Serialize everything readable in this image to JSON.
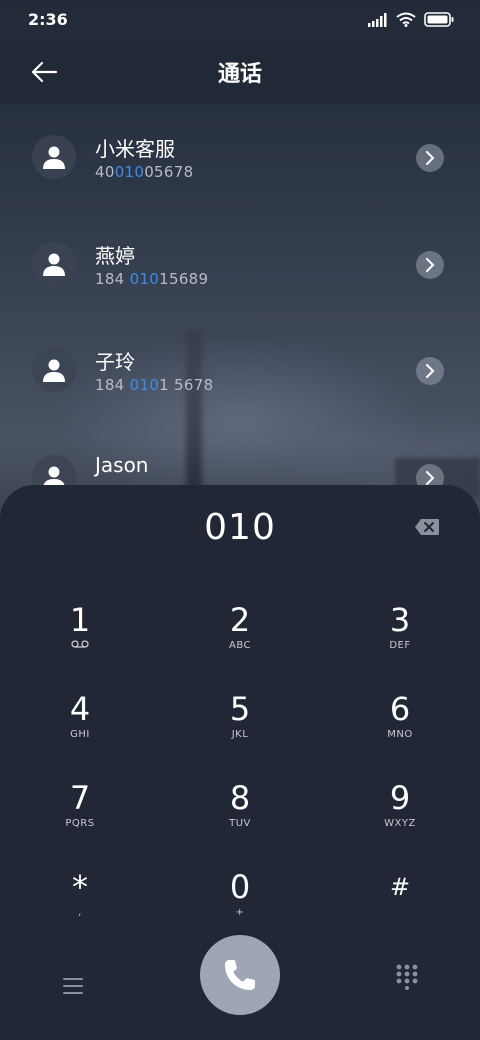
{
  "status_bar": {
    "time": "2:36"
  },
  "header": {
    "title": "通话"
  },
  "contacts": [
    {
      "name": "小米客服",
      "number_pre": "40",
      "number_match": "010",
      "number_post": "05678"
    },
    {
      "name": "燕婷",
      "number_pre": "184 ",
      "number_match": "010",
      "number_post": "15689"
    },
    {
      "name": "子玲",
      "number_pre": "184 ",
      "number_match": "010",
      "number_post": "1 5678"
    },
    {
      "name": "Jason",
      "number_pre": "",
      "number_match": "",
      "number_post": ""
    }
  ],
  "dialer": {
    "entry": "010",
    "keys": [
      {
        "digit": "1",
        "letters": ""
      },
      {
        "digit": "2",
        "letters": "ABC"
      },
      {
        "digit": "3",
        "letters": "DEF"
      },
      {
        "digit": "4",
        "letters": "GHI"
      },
      {
        "digit": "5",
        "letters": "JKL"
      },
      {
        "digit": "6",
        "letters": "MNO"
      },
      {
        "digit": "7",
        "letters": "PQRS"
      },
      {
        "digit": "8",
        "letters": "TUV"
      },
      {
        "digit": "9",
        "letters": "WXYZ"
      },
      {
        "digit": "*",
        "letters": ","
      },
      {
        "digit": "0",
        "letters": "+"
      },
      {
        "digit": "#",
        "letters": ""
      }
    ]
  },
  "colors": {
    "accent": "#3a8ee6",
    "pad_bg": "#212735",
    "call_button": "#9ea6b5"
  }
}
